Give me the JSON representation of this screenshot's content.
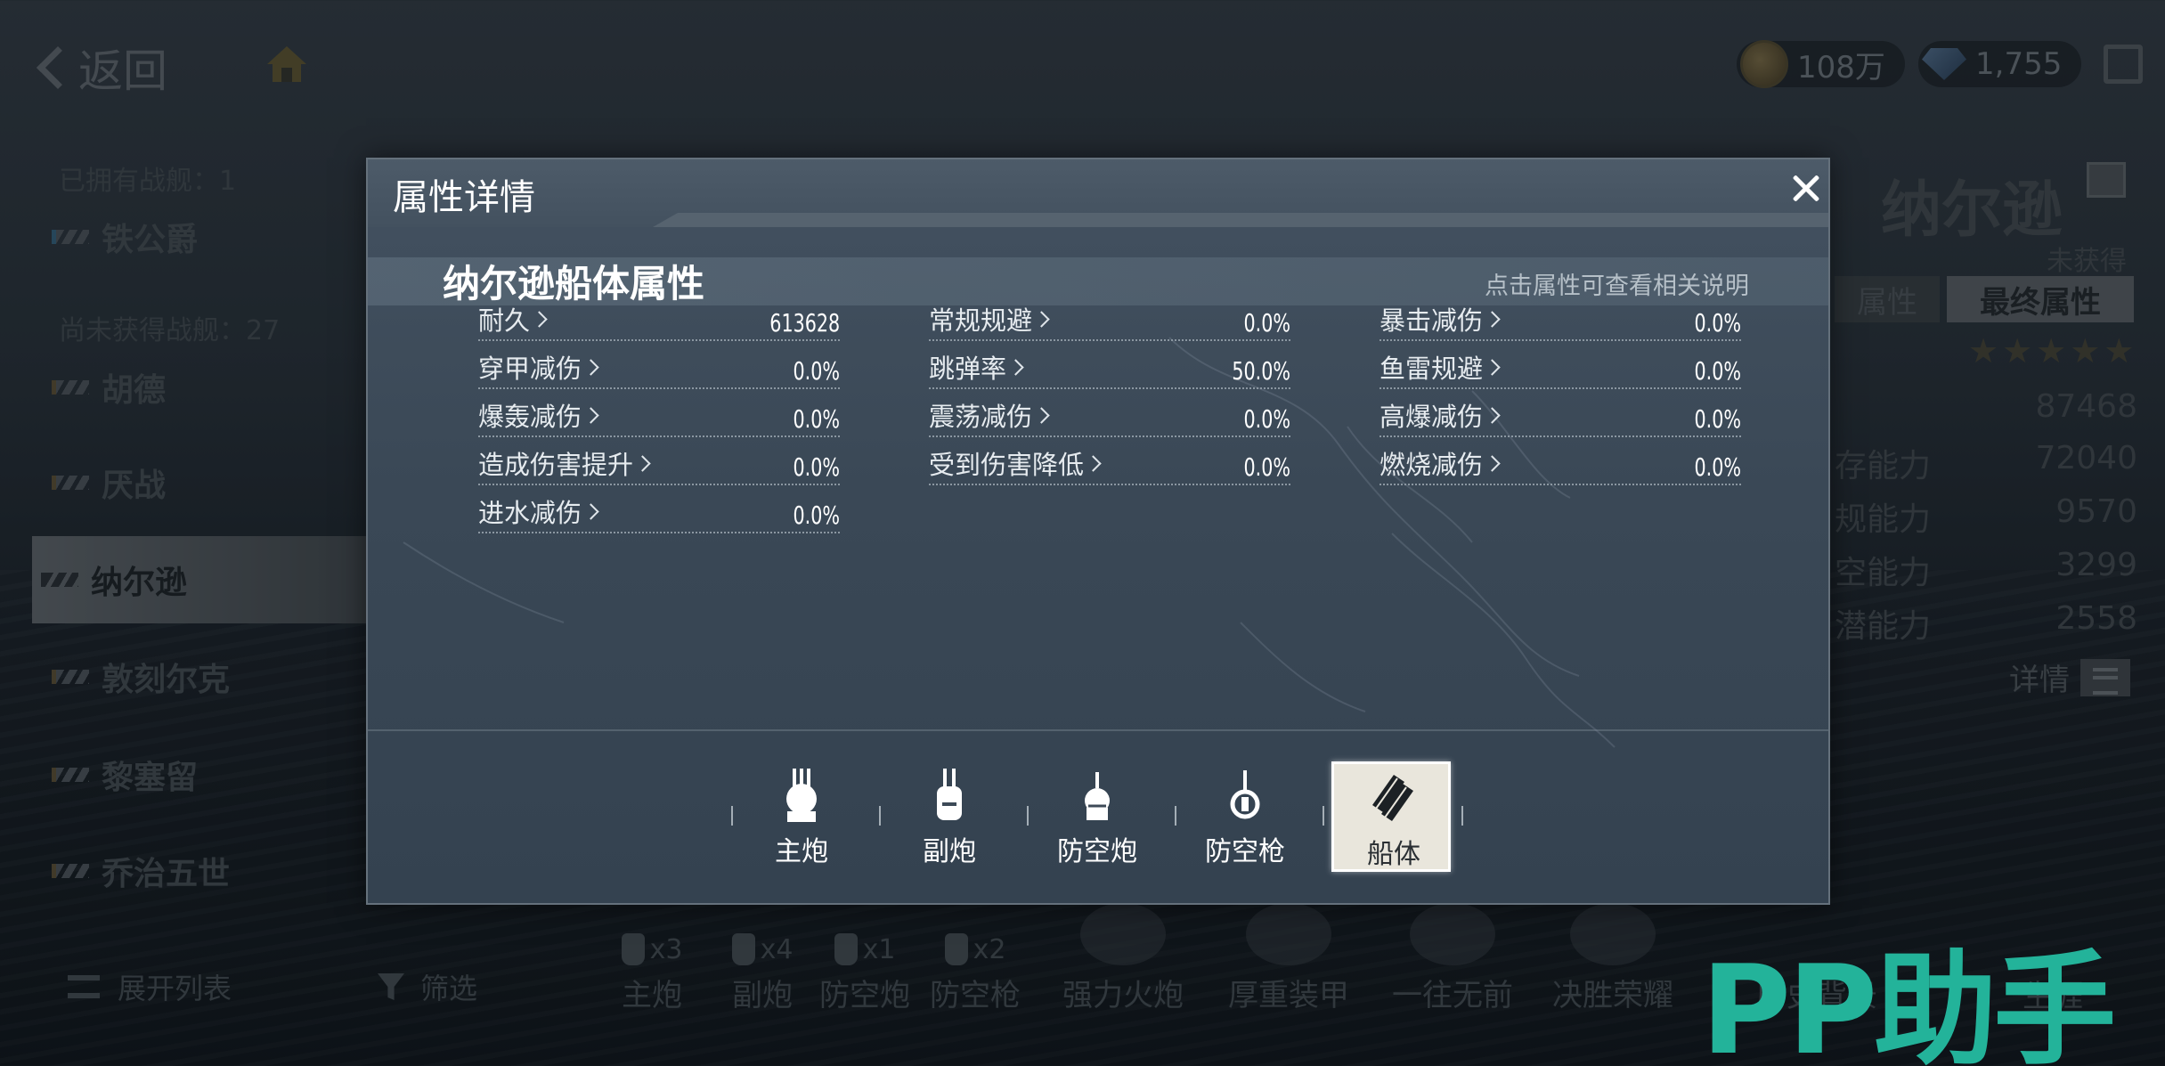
{
  "topbar": {
    "back_label": "返回",
    "coins": "108万",
    "gems": "1,755"
  },
  "ship_list": {
    "owned_label": "已拥有战舰：1",
    "unowned_label": "尚未获得战舰：27",
    "ships": [
      {
        "name": "铁公爵"
      },
      {
        "name": "胡德"
      },
      {
        "name": "厌战"
      },
      {
        "name": "纳尔逊"
      },
      {
        "name": "敦刻尔克"
      },
      {
        "name": "黎塞留"
      },
      {
        "name": "乔治五世"
      }
    ],
    "expand_label": "展开列表",
    "filter_label": "筛选"
  },
  "ship_info": {
    "name": "纳尔逊",
    "status": "未获得",
    "tab_attr": "属性",
    "tab_final": "最终属性",
    "stats": [
      {
        "label": "",
        "value": "87468"
      },
      {
        "label": "存能力",
        "value": "72040"
      },
      {
        "label": "规能力",
        "value": "9570"
      },
      {
        "label": "空能力",
        "value": "3299"
      },
      {
        "label": "潜能力",
        "value": "2558"
      }
    ],
    "details_label": "详情"
  },
  "bottom_bar": {
    "weapons": [
      {
        "label": "主炮",
        "count": "x3"
      },
      {
        "label": "副炮",
        "count": "x4"
      },
      {
        "label": "防空炮",
        "count": "x1"
      },
      {
        "label": "防空枪",
        "count": "x2"
      }
    ],
    "skills": [
      {
        "label": "强力火炮"
      },
      {
        "label": "厚重装甲"
      },
      {
        "label": "一往无前"
      },
      {
        "label": "决胜荣耀"
      }
    ],
    "history_label": "历史背景",
    "career_label": "生涯"
  },
  "watermark": "PP助手",
  "dialog": {
    "title": "属性详情",
    "section_title": "纳尔逊船体属性",
    "hint": "点击属性可查看相关说明",
    "attributes": [
      {
        "name": "耐久",
        "value": "613628"
      },
      {
        "name": "常规规避",
        "value": "0.0%"
      },
      {
        "name": "暴击减伤",
        "value": "0.0%"
      },
      {
        "name": "穿甲减伤",
        "value": "0.0%"
      },
      {
        "name": "跳弹率",
        "value": "50.0%"
      },
      {
        "name": "鱼雷规避",
        "value": "0.0%"
      },
      {
        "name": "爆轰减伤",
        "value": "0.0%"
      },
      {
        "name": "震荡减伤",
        "value": "0.0%"
      },
      {
        "name": "高爆减伤",
        "value": "0.0%"
      },
      {
        "name": "造成伤害提升",
        "value": "0.0%"
      },
      {
        "name": "受到伤害降低",
        "value": "0.0%"
      },
      {
        "name": "燃烧减伤",
        "value": "0.0%"
      },
      {
        "name": "进水减伤",
        "value": "0.0%"
      }
    ],
    "tabs": [
      {
        "label": "主炮",
        "icon": "main-gun-icon"
      },
      {
        "label": "副炮",
        "icon": "secondary-gun-icon"
      },
      {
        "label": "防空炮",
        "icon": "aa-cannon-icon"
      },
      {
        "label": "防空枪",
        "icon": "aa-gun-icon"
      },
      {
        "label": "船体",
        "icon": "hull-icon",
        "active": true
      }
    ]
  }
}
